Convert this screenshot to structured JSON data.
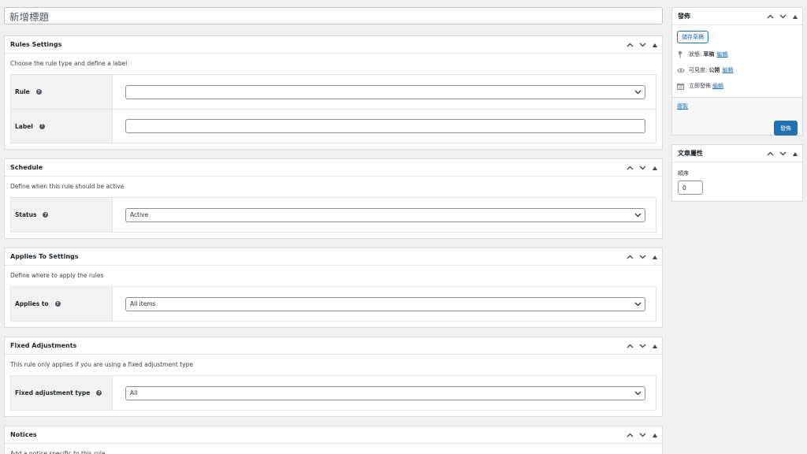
{
  "title_input": {
    "value": "新增標題"
  },
  "sections": [
    {
      "title": "Rules Settings",
      "description": "Choose the rule type and define a label",
      "rows": [
        {
          "label": "Rule",
          "type": "select",
          "value": ""
        },
        {
          "label": "Label",
          "type": "text",
          "value": ""
        }
      ]
    },
    {
      "title": "Schedule",
      "description": "Define when this rule should be active",
      "rows": [
        {
          "label": "Status",
          "type": "select",
          "value": "Active"
        }
      ]
    },
    {
      "title": "Applies To Settings",
      "description": "Define where to apply the rules",
      "rows": [
        {
          "label": "Applies to",
          "type": "select",
          "value": "All items"
        }
      ]
    },
    {
      "title": "Fixed Adjustments",
      "description": "This rule only applies if you are using a fixed adjustment type",
      "rows": [
        {
          "label": "Fixed adjustment type",
          "type": "select",
          "value": "All"
        }
      ]
    },
    {
      "title": "Notices",
      "description": "Add a notice specific to this rule",
      "rows": []
    }
  ],
  "publish": {
    "title": "發佈",
    "save_draft": "儲存草稿",
    "status_label": "狀態:",
    "status_value": "草稿",
    "status_edit": "編輯",
    "visibility_label": "可見度:",
    "visibility_value": "公開",
    "visibility_edit": "編輯",
    "schedule_label": "立即發佈",
    "schedule_edit": "編輯",
    "copy_link": "複製",
    "publish_button": "發佈"
  },
  "attributes": {
    "title": "文章屬性",
    "order_label": "順序",
    "order_value": "0"
  },
  "icons": {
    "collapse_up": "chevron-up-icon",
    "collapse_down": "chevron-down-icon",
    "toggle": "triangle-up-icon",
    "help": "question-mark-icon",
    "status": "pin-icon",
    "visibility": "eye-icon",
    "calendar": "calendar-icon"
  },
  "colors": {
    "accent": "#2271b1",
    "background": "#f0f0f1"
  }
}
